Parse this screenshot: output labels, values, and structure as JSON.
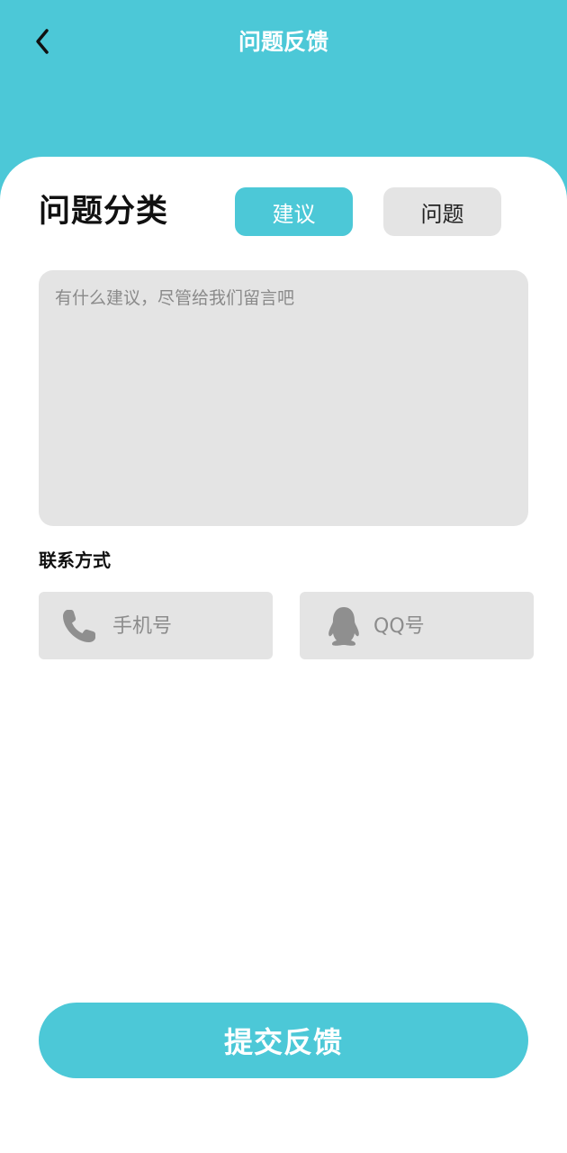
{
  "header": {
    "title": "问题反馈",
    "back_icon": "chevron-left-icon"
  },
  "category": {
    "label": "问题分类",
    "options": [
      {
        "label": "建议",
        "selected": true
      },
      {
        "label": "问题",
        "selected": false
      }
    ]
  },
  "feedback": {
    "value": "",
    "placeholder": "有什么建议，尽管给我们留言吧"
  },
  "contact": {
    "label": "联系方式",
    "phone": {
      "placeholder": "手机号",
      "value": "",
      "icon": "phone-icon"
    },
    "qq": {
      "placeholder": "QQ号",
      "value": "",
      "icon": "qq-penguin-icon"
    }
  },
  "submit": {
    "label": "提交反馈"
  },
  "colors": {
    "accent": "#4cc8d7",
    "field_bg": "#e4e4e4",
    "placeholder": "#8a8a8a"
  }
}
